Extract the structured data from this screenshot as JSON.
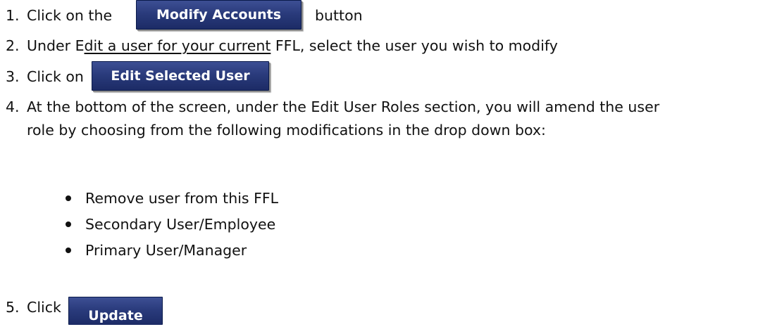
{
  "steps": [
    {
      "num": "1.",
      "text_before": "Click on the",
      "button": "Modify Accounts",
      "text_after": "button"
    },
    {
      "num": "2.",
      "text_a": "Under E",
      "text_b": "dit a user for your current",
      "text_c": " FFL, select the user you wish to modify"
    },
    {
      "num": "3.",
      "text_before": "Click on",
      "button": "Edit Selected User"
    },
    {
      "num": "4.",
      "text_line1": "At the bottom of the screen, under the Edit User Roles section, you will amend the user",
      "text_line2": "role by choosing from the following modifications in the drop down box:"
    },
    {
      "num": "5.",
      "text_before": "Click",
      "button": "Update"
    }
  ],
  "options": [
    "Remove user from this FFL",
    "Secondary User/Employee",
    "Primary User/Manager"
  ],
  "colors": {
    "button_bg": "#2a3b7c",
    "button_text": "#ffffff",
    "text": "#111111"
  }
}
